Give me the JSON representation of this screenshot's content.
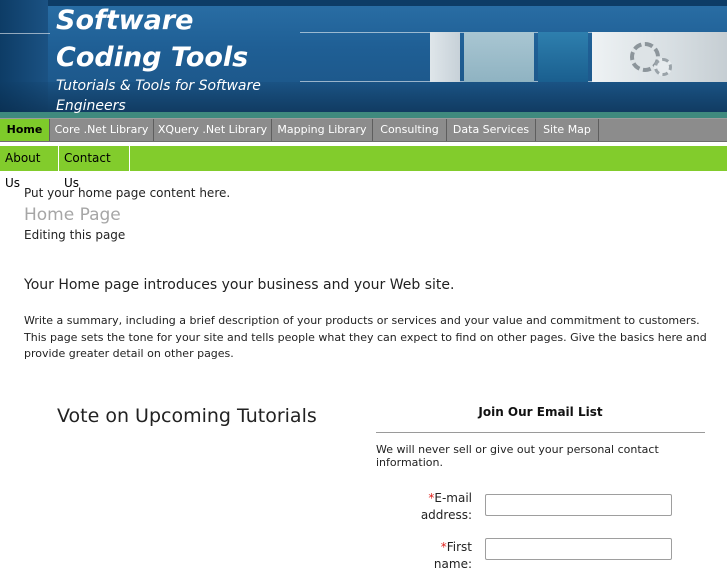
{
  "header": {
    "site_title": "Software Coding Tools",
    "tagline": "Tutorials & Tools for Software Engineers"
  },
  "topnav": {
    "items": [
      {
        "label": "Home",
        "active": true
      },
      {
        "label": "Core .Net Library",
        "active": false
      },
      {
        "label": "XQuery .Net Library",
        "active": false
      },
      {
        "label": "Mapping Library",
        "active": false
      },
      {
        "label": "Consulting",
        "active": false
      },
      {
        "label": "Data Services",
        "active": false
      },
      {
        "label": "Site Map",
        "active": false
      }
    ]
  },
  "subnav": {
    "items": [
      {
        "label": "About Us"
      },
      {
        "label": "Contact Us"
      }
    ]
  },
  "content": {
    "placeholder": "Put your home page content here.",
    "page_heading": "Home Page",
    "editing": "Editing this page",
    "intro": "Your Home page introduces your business and your Web site.",
    "summary": "Write a summary, including a brief description of your products or services and your value and commitment to customers. This page sets the tone for your site and tells people what they can expect to find on other pages. Give the basics here and provide greater detail on other pages.",
    "vote_heading": "Vote on Upcoming Tutorials"
  },
  "email_list": {
    "title": "Join Our Email List",
    "note": "We will never sell or give out your personal contact information.",
    "required_mark": "*",
    "email_label": "E-mail address:",
    "email_value": "",
    "name_label": "First name:",
    "name_value": ""
  },
  "colors": {
    "header_blue": "#1f5f95",
    "nav_gray": "#8c8c8c",
    "nav_active_green": "#7ecb2a",
    "subnav_green": "#82cc2c",
    "required_red": "#e0201b"
  }
}
